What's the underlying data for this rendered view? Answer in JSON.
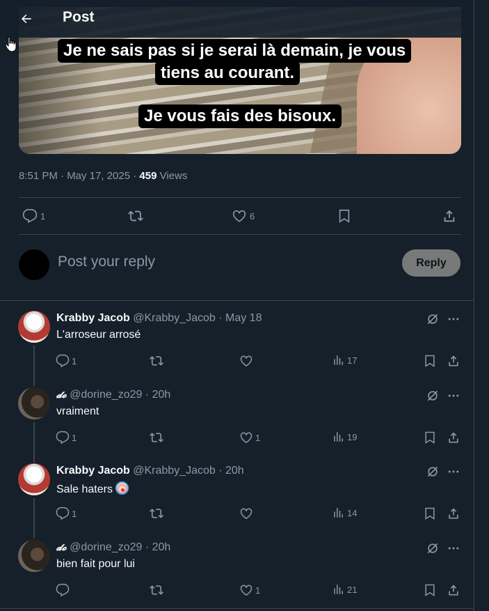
{
  "header": {
    "title": "Post"
  },
  "media": {
    "caption_line1": "Je ne sais pas si je serai là demain, je vous",
    "caption_line2": "tiens au courant.",
    "caption_line3": "Je vous fais des bisoux."
  },
  "post": {
    "time": "8:51 PM · May 17, 2025 · ",
    "views_count": "459",
    "views_label": " Views",
    "replies": "1",
    "likes": "6"
  },
  "composer": {
    "placeholder": "Post your reply",
    "reply_label": "Reply"
  },
  "replies": [
    {
      "name": "Krabby Jacob",
      "handle": " @Krabby_Jacob · May 18",
      "text": "L'arroseur arrosé",
      "replies": "1",
      "likes": "",
      "views": "17"
    },
    {
      "name": "𝓭𝓸",
      "handle": " @dorine_zo29 · 20h",
      "text": "vraiment",
      "replies": "1",
      "likes": "1",
      "views": "19"
    },
    {
      "name": "Krabby Jacob",
      "handle": " @Krabby_Jacob · 20h",
      "text": "Sale haters ",
      "replies": "1",
      "likes": "",
      "views": "14"
    },
    {
      "name": "𝓭𝓸",
      "handle": " @dorine_zo29 · 20h",
      "text": "bien fait pour lui",
      "replies": "",
      "likes": "1",
      "views": "21"
    }
  ],
  "icons": {
    "back": "back-arrow-icon",
    "reply": "reply-icon",
    "repost": "repost-icon",
    "like": "heart-icon",
    "bookmark": "bookmark-icon",
    "share": "share-icon",
    "views": "views-icon",
    "grok": "grok-icon",
    "more": "more-icon"
  },
  "colors": {
    "background": "#15202b",
    "muted": "#8b98a5",
    "border": "#38444d",
    "reply_button": "#787a7a"
  }
}
